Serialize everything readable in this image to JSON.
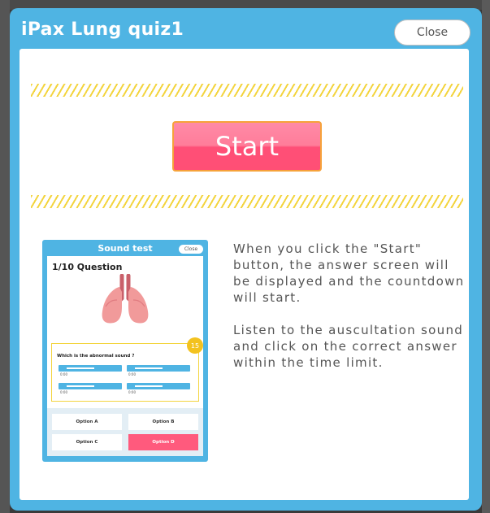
{
  "modal": {
    "title": "iPax Lung quiz1",
    "close_label": "Close"
  },
  "start_label": "Start",
  "description": [
    "When you click the \"Start\" button, the answer screen will be displayed and the countdown will start.",
    "Listen to the auscultation sound and click on the correct answer within the time limit."
  ],
  "preview": {
    "title": "Sound test",
    "close_label": "Close",
    "question_label": "1/10 Question",
    "prompt": "Which is the abnormal sound ?",
    "countdown": "15",
    "player_time": "0:00",
    "options": [
      "Option A",
      "Option B",
      "Option C",
      "Option D"
    ],
    "selected_option": "Option D"
  },
  "colors": {
    "frame": "#4fb4e3",
    "stripe": "#f3d43e",
    "start_button": "#ff5a7d",
    "start_border": "#f6a23a"
  }
}
